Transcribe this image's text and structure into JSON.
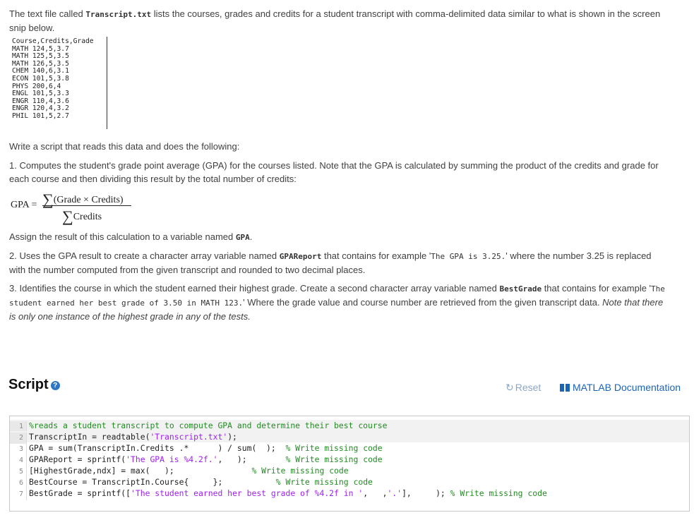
{
  "intro": {
    "t1": "The text file called ",
    "file": "Transcript.txt",
    "t2": " lists the courses, grades and credits for a student transcript with comma-delimited data similar to what is shown in the screen snip below."
  },
  "snip": {
    "lines": [
      "Course,Credits,Grade",
      "MATH 124,5,3.7",
      "MATH 125,5,3.5",
      "MATH 126,5,3.5",
      "CHEM 140,6,3.1",
      "ECON 101,5,3.8",
      "PHYS 200,6,4",
      "ENGL 101,5,3.3",
      "ENGR 110,4,3.6",
      "ENGR 120,4,3.2",
      "PHIL 101,5,2.7"
    ]
  },
  "task": {
    "intro": "Write a script that reads this data and does the following:",
    "step1": "1. Computes the student's grade point average (GPA) for the courses listed. Note that the GPA is calculated by summing the product of the credits and grade for each course and then dividing this result by the total number of credits:",
    "formula_lhs": "GPA =",
    "formula_sigma": "∑",
    "formula_num": "(Grade × Credits)",
    "formula_den": "Credits",
    "assign_t1": "Assign the result of this calculation to a variable named ",
    "assign_var": "GPA",
    "assign_t2": ".",
    "step2_t1": "2. Uses the GPA result to create a character array variable named ",
    "step2_var": "GPAReport",
    "step2_t2": " that contains for example '",
    "step2_ex": "The GPA is 3.25.",
    "step2_t3": "' where the number 3.25 is replaced with the number computed from the given transcript and rounded to two decimal places.",
    "step3_t1": "3. Identifies the course in which the student earned their highest grade. Create a second character array variable named ",
    "step3_var": "BestGrade",
    "step3_t2": " that contains for example '",
    "step3_ex": "The student earned her best grade of 3.50 in MATH 123.",
    "step3_t3": "' Where the grade value and course number are retrieved from the given transcript data. ",
    "step3_note": "Note that there is only one instance of the highest grade in any of the tests."
  },
  "script": {
    "title": "Script",
    "help_icon": "?",
    "reset_label": "Reset",
    "doc_label": "MATLAB Documentation"
  },
  "editor": {
    "line_numbers": [
      "1",
      "2",
      "3",
      "4",
      "5",
      "6",
      "7"
    ],
    "l1_comment": "%reads a student transcript to compute GPA and determine their best course",
    "l2_a": "TranscriptIn = readtable(",
    "l2_str": "'Transcript.txt'",
    "l2_b": ");",
    "l3_a": "GPA = sum(TranscriptIn.Credits .*      ) / sum(  );  ",
    "l3_cm": "% Write missing code",
    "l4_a": "GPAReport = sprintf(",
    "l4_str": "'The GPA is %4.2f.'",
    "l4_b": ",   );        ",
    "l4_cm": "% Write missing code",
    "l5_a": "[HighestGrade,ndx] = max(   );                ",
    "l5_cm": "% Write missing code",
    "l6_a": "BestCourse = TranscriptIn.Course{     };           ",
    "l6_cm": "% Write missing code",
    "l7_a": "BestGrade = sprintf([",
    "l7_str1": "'The student earned her best grade of %4.2f in '",
    "l7_b": ",   ,",
    "l7_str2": "'.'",
    "l7_c": "],     ); ",
    "l7_cm": "% Write missing code"
  }
}
